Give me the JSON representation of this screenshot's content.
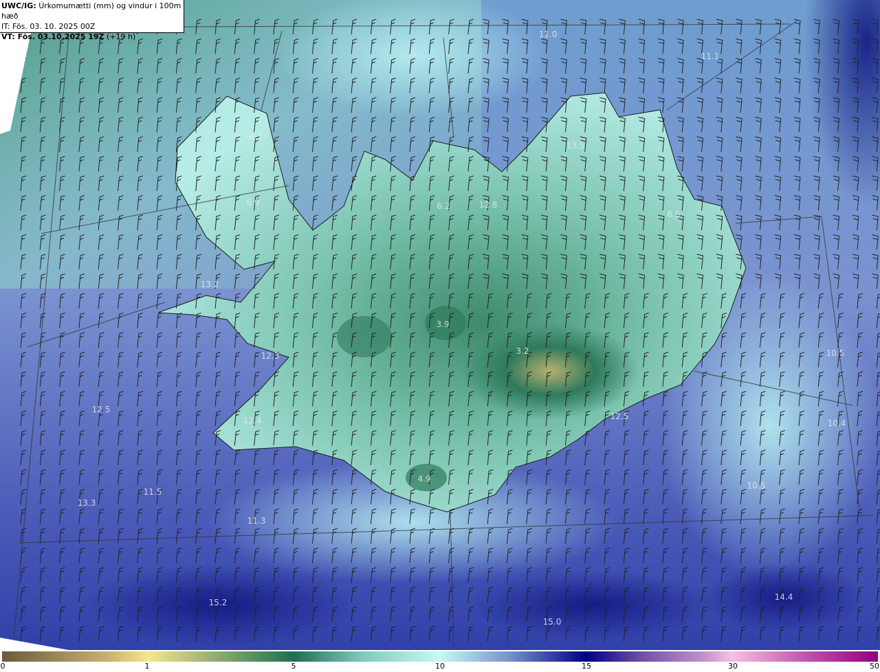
{
  "header": {
    "model": "UWC/IG:",
    "description": "Úrkomumætti (mm) og vindur i 100m hæð",
    "initial_time": "IT: Fös. 03. 10. 2025 00Z",
    "valid_time_bold": "VT: Fös. 03.10.2025 19Z",
    "forecast_offset": "(+19 h)"
  },
  "colorbar": {
    "ticks": [
      "0",
      "1",
      "5",
      "10",
      "15",
      "30",
      "50"
    ],
    "colors": [
      "#6b5a3e",
      "#f5e68c",
      "#1e6e55",
      "#c8f8f8",
      "#000080",
      "#f8c0e0",
      "#900080"
    ]
  },
  "map": {
    "value_labels": [
      "11.0",
      "11.1",
      "13.5",
      "6.7",
      "6.9",
      "6.2",
      "12.8",
      "6.5",
      "13.2",
      "12.3",
      "3.9",
      "3.2",
      "12.5",
      "12.4",
      "12.5",
      "10.4",
      "10.5",
      "11.5",
      "13.3",
      "4.9",
      "10.5",
      "11.3",
      "15.2",
      "15.0",
      "14.4"
    ],
    "land_color": "#5fa88e",
    "sea_color": "#6e86c8"
  }
}
